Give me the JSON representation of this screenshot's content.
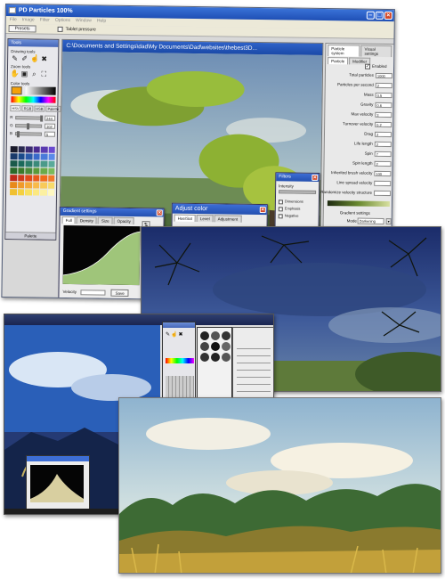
{
  "window": {
    "title": "PD Particles   100%",
    "menu": [
      "File",
      "Image",
      "Filter",
      "Options",
      "Window",
      "Help"
    ],
    "toolbar": {
      "button_label": "Presets",
      "checkbox_label": "Tablet pressure"
    }
  },
  "tools_panel": {
    "title": "Tools",
    "drawing_tools_label": "Drawing tools",
    "zoom_tools_label": "Zoom tools",
    "color_tools_label": "Color tools",
    "color_tabs": [
      "HSV",
      "RGB",
      "HSB",
      "Palette"
    ],
    "sliders": [
      {
        "label": "R",
        "value": "244"
      },
      {
        "label": "G",
        "value": "102"
      },
      {
        "label": "B",
        "value": "5"
      }
    ],
    "footer": "Palette"
  },
  "document": {
    "title": "C:\\Documents and Settings\\dad\\My Documents\\Dad\\websites\\thebest3D..."
  },
  "properties": {
    "tabs": [
      "Particle system",
      "Visual settings"
    ],
    "subtabs": [
      "Particle",
      "Modifier"
    ],
    "enabled_label": "Enabled",
    "rows": [
      {
        "label": "Total particles",
        "value": "1000"
      },
      {
        "label": "Particles per second",
        "value": "2"
      },
      {
        "label": "Mass",
        "value": "0.5"
      },
      {
        "label": "Gravity",
        "value": "0.6"
      },
      {
        "label": "Max velocity",
        "value": "3"
      },
      {
        "label": "Turnover velocity",
        "value": "0.2"
      },
      {
        "label": "Drag",
        "value": "2"
      },
      {
        "label": "Life length",
        "value": "2"
      },
      {
        "label": "Spin",
        "value": "7"
      },
      {
        "label": "Spin length",
        "value": "2"
      },
      {
        "label": "Inherited brush velocity",
        "value": "100"
      },
      {
        "label": "Line spread velocity",
        "value": ""
      },
      {
        "label": "Randomize velocity structure",
        "value": ""
      }
    ],
    "gradient_label": "Gradient settings",
    "mode_label": "Mode",
    "mode_value": "Darkening",
    "extra_rows": [
      "Size",
      "Spin"
    ]
  },
  "gradient_dialog": {
    "title": "Gradient settings",
    "tabs": [
      "Full",
      "Density",
      "Size",
      "Opacity"
    ],
    "bottom_label": "Velocity",
    "button": "Save"
  },
  "adjust_dialog": {
    "title": "Adjust color",
    "tabs": [
      "Hue/Sat",
      "Level",
      "Adjustment"
    ]
  },
  "filters_dialog": {
    "title": "Filters",
    "intensity_label": "Intensity",
    "options": [
      "Dimensions",
      "Emphasis",
      "Negative"
    ]
  },
  "colors": {
    "title_blue": "#2a5cc4",
    "panel_grey": "#e9e9e9",
    "close_red": "#d2492b"
  }
}
